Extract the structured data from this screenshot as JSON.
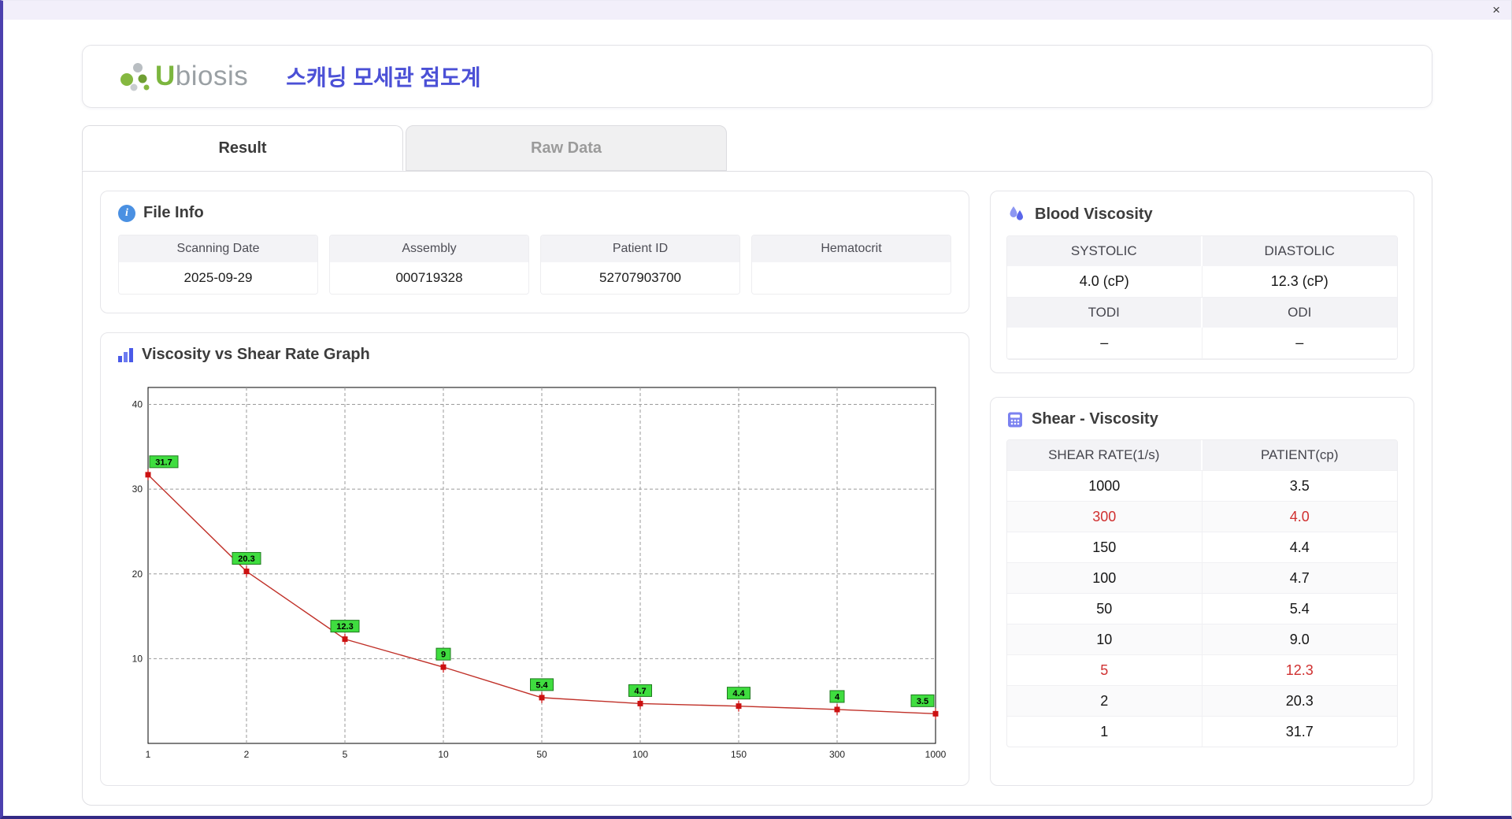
{
  "window": {
    "close_label": "×"
  },
  "header": {
    "logo_u": "U",
    "logo_rest": "biosis",
    "title": "스캐닝 모세관 점도계"
  },
  "tabs": [
    {
      "label": "Result"
    },
    {
      "label": "Raw Data"
    }
  ],
  "file_info": {
    "title": "File Info",
    "fields": [
      {
        "label": "Scanning Date",
        "value": "2025-09-29"
      },
      {
        "label": "Assembly",
        "value": "000719328"
      },
      {
        "label": "Patient ID",
        "value": "52707903700"
      },
      {
        "label": "Hematocrit",
        "value": ""
      }
    ]
  },
  "graph": {
    "title": "Viscosity vs Shear Rate Graph"
  },
  "chart_data": {
    "type": "line",
    "title": "Viscosity vs Shear Rate Graph",
    "x_categories": [
      "1",
      "2",
      "5",
      "10",
      "50",
      "100",
      "150",
      "300",
      "1000"
    ],
    "x_numeric": [
      1,
      2,
      5,
      10,
      50,
      100,
      150,
      300,
      1000
    ],
    "values": [
      31.7,
      20.3,
      12.3,
      9,
      5.4,
      4.7,
      4.4,
      4,
      3.5
    ],
    "point_labels": [
      "31.7",
      "20.3",
      "12.3",
      "9",
      "5.4",
      "4.7",
      "4.4",
      "4",
      "3.5"
    ],
    "xlabel": "",
    "ylabel": "",
    "ylim": [
      0,
      42
    ],
    "yticks": [
      10,
      20,
      30,
      40
    ],
    "x_axis": "categorical ticks at log-spaced shear rates",
    "grid": true,
    "legend": false,
    "line_color": "#c03028",
    "marker_color": "#cc1111",
    "label_bg": "#3fdd3f",
    "label_border": "#1f7a1f"
  },
  "blood_viscosity": {
    "title": "Blood Viscosity",
    "groups": [
      {
        "labels": [
          "SYSTOLIC",
          "DIASTOLIC"
        ],
        "values": [
          "4.0 (cP)",
          "12.3 (cP)"
        ]
      },
      {
        "labels": [
          "TODI",
          "ODI"
        ],
        "values": [
          "–",
          "–"
        ]
      }
    ]
  },
  "shear_viscosity": {
    "title": "Shear - Viscosity",
    "columns": [
      "SHEAR RATE(1/s)",
      "PATIENT(cp)"
    ],
    "highlight_color": "#d03030",
    "rows": [
      {
        "shear_rate": "1000",
        "patient": "3.5",
        "highlight": false
      },
      {
        "shear_rate": "300",
        "patient": "4.0",
        "highlight": true
      },
      {
        "shear_rate": "150",
        "patient": "4.4",
        "highlight": false
      },
      {
        "shear_rate": "100",
        "patient": "4.7",
        "highlight": false
      },
      {
        "shear_rate": "50",
        "patient": "5.4",
        "highlight": false
      },
      {
        "shear_rate": "10",
        "patient": "9.0",
        "highlight": false
      },
      {
        "shear_rate": "5",
        "patient": "12.3",
        "highlight": true
      },
      {
        "shear_rate": "2",
        "patient": "20.3",
        "highlight": false
      },
      {
        "shear_rate": "1",
        "patient": "31.7",
        "highlight": false
      }
    ]
  }
}
